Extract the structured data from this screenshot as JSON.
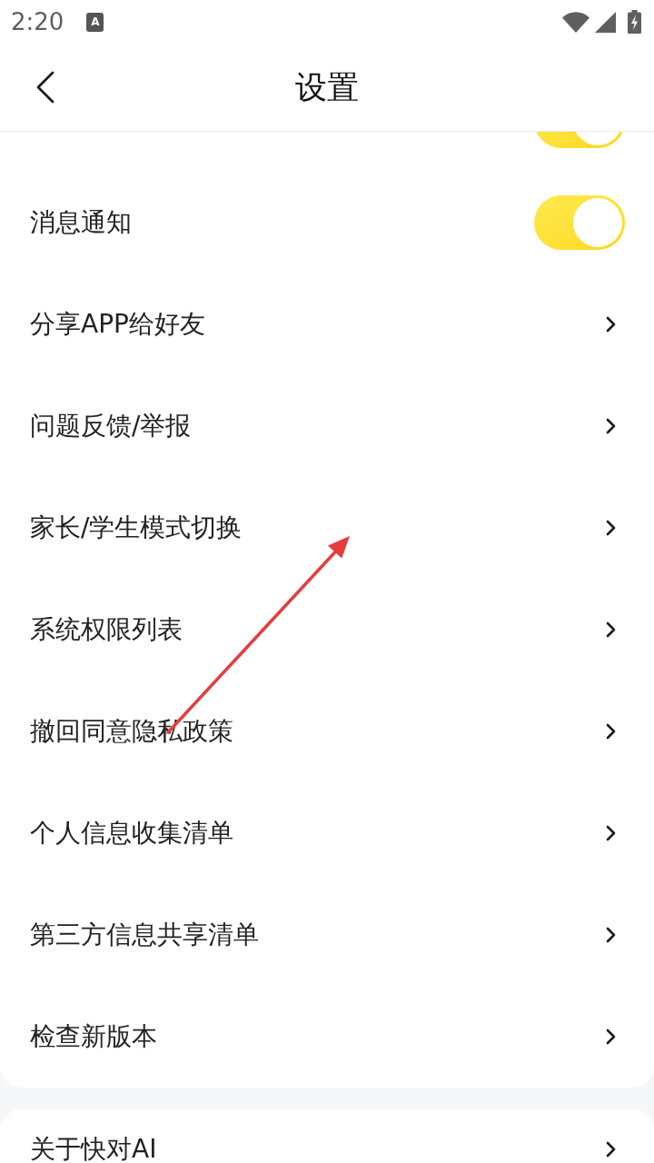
{
  "status_bar": {
    "time": "2:20",
    "notification_icon_letter": "A"
  },
  "header": {
    "title": "设置"
  },
  "settings": [
    {
      "kind": "toggle",
      "on": true
    },
    {
      "kind": "toggle",
      "label": "消息通知",
      "on": true
    },
    {
      "kind": "link",
      "label": "分享APP给好友"
    },
    {
      "kind": "link",
      "label": "问题反馈/举报"
    },
    {
      "kind": "link",
      "label": "家长/学生模式切换"
    },
    {
      "kind": "link",
      "label": "系统权限列表"
    },
    {
      "kind": "link",
      "label": "撤回同意隐私政策"
    },
    {
      "kind": "link",
      "label": "个人信息收集清单"
    },
    {
      "kind": "link",
      "label": "第三方信息共享清单"
    },
    {
      "kind": "link",
      "label": "检查新版本"
    }
  ],
  "about": [
    {
      "kind": "link",
      "label": "关于快对AI"
    }
  ]
}
